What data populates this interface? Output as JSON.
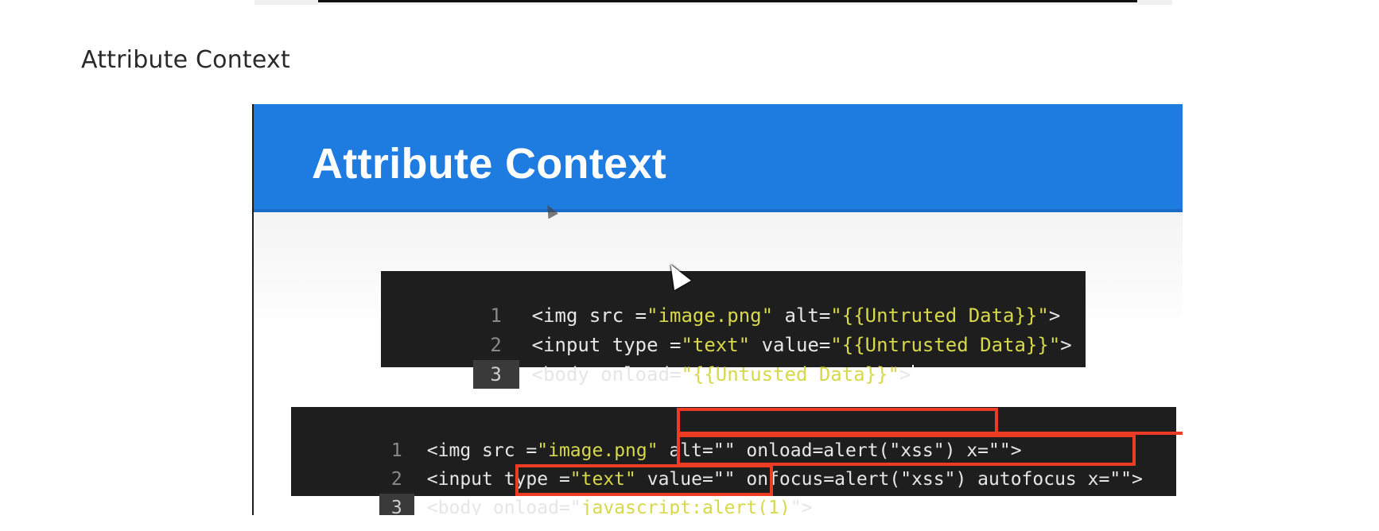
{
  "section": {
    "heading": "Attribute Context"
  },
  "slide": {
    "title": "Attribute Context",
    "colors": {
      "header": "#1e7be0",
      "code_background": "#1e1e1e",
      "string": "#d7d84a",
      "highlight": "#ee3b24"
    },
    "code_block_1": {
      "lines": [
        {
          "number": "1",
          "text": "<img src =\"image.png\" alt=\"{{Untruted Data}}\">"
        },
        {
          "number": "2",
          "text": "<input type =\"text\" value=\"{{Untrusted Data}}\">"
        },
        {
          "number": "3",
          "text": "<body onload=\"{{Untusted Data}}\">"
        }
      ]
    },
    "code_block_2": {
      "lines": [
        {
          "number": "1",
          "prefix": "<img src =\"image.png\" alt=\"",
          "payload": "\" onload=alert(\"xss\") x=\"",
          "suffix": "\">"
        },
        {
          "number": "2",
          "prefix": "<input type =\"text\" value=\"",
          "payload": "\" onfocus=alert(\"xss\") autofocus x=\"",
          "suffix": "\">"
        },
        {
          "number": "3",
          "prefix": "<body onload=\"",
          "payload": "javascript:alert(1)",
          "suffix": "\">"
        }
      ]
    }
  }
}
